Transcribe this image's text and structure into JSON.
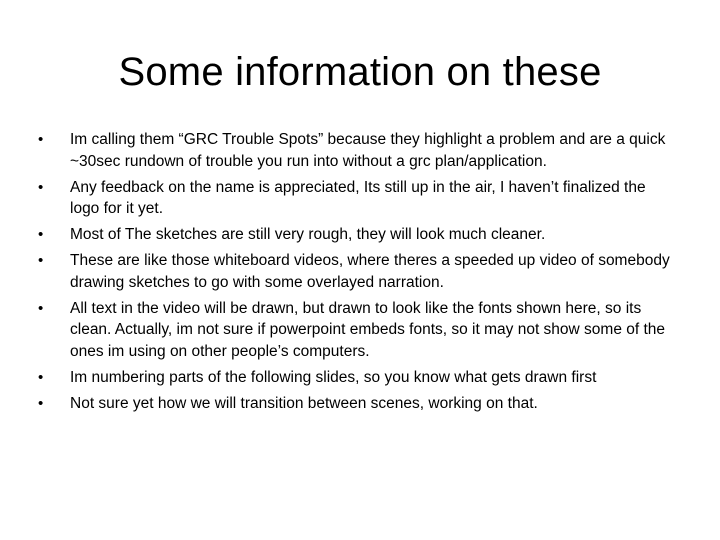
{
  "slide": {
    "title": "Some information on these",
    "bullet_glyph": "•",
    "bullets": [
      "Im calling them “GRC Trouble Spots” because they highlight a problem and are a quick ~30sec rundown of trouble you run into without a grc plan/application.",
      "Any feedback on the name is appreciated, Its still up in the air, I haven’t finalized the logo for it yet.",
      "Most of The sketches are still very rough, they will look much cleaner.",
      "These are like those whiteboard videos, where theres a speeded up video of somebody drawing sketches to go with some overlayed narration.",
      "All text in the video will be drawn, but drawn to look like the fonts shown here, so its clean. Actually, im not sure if powerpoint embeds fonts, so it may not show some of the ones im using on other people’s computers.",
      "Im numbering parts of the following slides, so you know what gets drawn first",
      "Not sure yet how we will transition between scenes, working on that."
    ]
  }
}
